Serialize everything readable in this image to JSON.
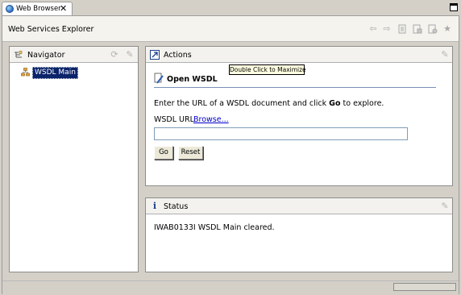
{
  "tab": {
    "title": "Web Browser",
    "close_glyph": "✕"
  },
  "header": {
    "title": "Web Services Explorer",
    "toolbar_icons": [
      "back-arrow-icon",
      "forward-arrow-icon",
      "page-icon",
      "page-refresh-icon",
      "page-settings-icon",
      "favorite-star-icon"
    ]
  },
  "navigator": {
    "title": "Navigator",
    "tree": [
      {
        "label": "WSDL Main",
        "selected": true
      }
    ]
  },
  "actions": {
    "title": "Actions",
    "tooltip": "Double Click to Maximize",
    "section_title": "Open WSDL",
    "instruction_prefix": "Enter the URL of a WSDL document and click",
    "instruction_bold": "Go",
    "instruction_suffix": "to explore.",
    "url_label": "WSDL URL",
    "browse_link": "Browse...",
    "url_value": "",
    "go_label": "Go",
    "reset_label": "Reset"
  },
  "status": {
    "title": "Status",
    "message": "IWAB0133I WSDL Main cleared."
  },
  "colors": {
    "selection": "#0a246a",
    "link": "#0000cc",
    "chrome": "#d4d0c8"
  }
}
